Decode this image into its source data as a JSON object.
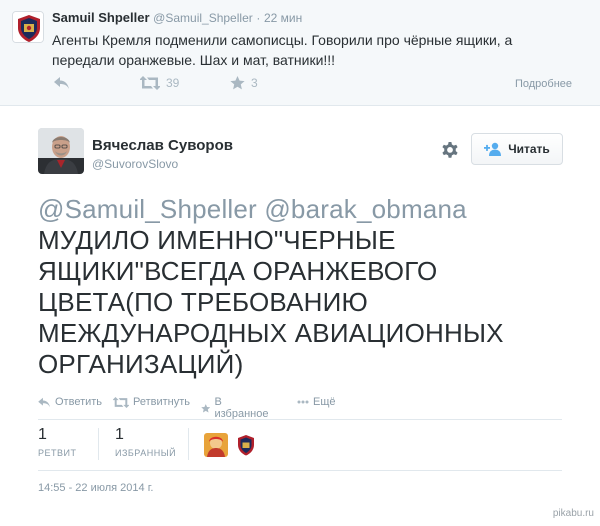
{
  "top_tweet": {
    "author_name": "Samuil Shpeller",
    "author_handle": "@Samuil_Shpeller",
    "separator": "·",
    "time": "22 мин",
    "text": "Агенты Кремля подменили самописцы. Говорили про чёрные ящики, а передали оранжевые. Шах и мат, ватники!!!",
    "retweet_count": "39",
    "favorite_count": "3",
    "details_label": "Подробнее",
    "icons": [
      "reply-icon",
      "retweet-icon",
      "star-icon"
    ]
  },
  "main_tweet": {
    "author_name": "Вячеслав Суворов",
    "author_handle": "@SuvorovSlovo",
    "follow_label": "Читать",
    "mentions": "@Samuil_Shpeller @barak_obmana",
    "text": "МУДИЛО ИМЕННО\"ЧЕРНЫЕ ЯЩИКИ\"ВСЕГДА ОРАНЖЕВОГО ЦВЕТА(ПО ТРЕБОВАНИЮ МЕЖДУНАРОДНЫХ АВИАЦИОННЫХ ОРГАНИЗАЦИЙ)",
    "actions": {
      "reply": "Ответить",
      "retweet": "Ретвитнуть",
      "favorite": "В избранное",
      "more": "Ещё"
    },
    "stats": {
      "retweets_count": "1",
      "retweets_label": "РЕТВИТ",
      "favorites_count": "1",
      "favorites_label": "ИЗБРАННЫЙ"
    },
    "timestamp": "14:55 - 22 июля 2014 г."
  },
  "watermark": "pikabu.ru",
  "colors": {
    "text": "#292f33",
    "muted": "#8899a6",
    "icon": "#aab8c2",
    "border": "#e1e8ed",
    "top_bg": "#f5f8fa",
    "follow_icon": "#55acee"
  }
}
